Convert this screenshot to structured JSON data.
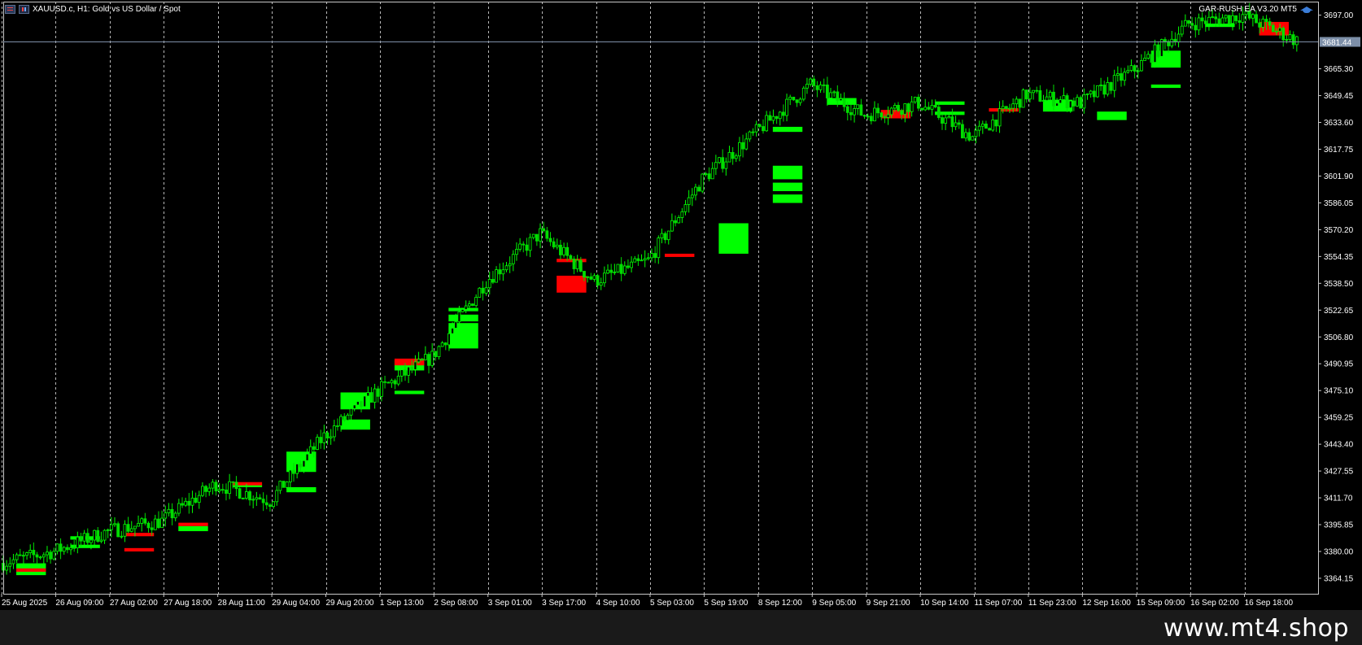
{
  "header": {
    "symbol_title": "XAUUSD.c, H1:  Gold vs US Dollar / Spot",
    "ea_label": "GAR-RUSH  EA V3.20 MT5",
    "icons": [
      "chart-menu-icon",
      "chart-type-icon",
      "expert-hat-icon"
    ]
  },
  "price_axis": {
    "labels": [
      "3697.00",
      "3665.30",
      "3649.45",
      "3633.60",
      "3617.75",
      "3601.90",
      "3586.05",
      "3570.20",
      "3554.35",
      "3538.50",
      "3522.65",
      "3506.80",
      "3490.95",
      "3475.10",
      "3459.25",
      "3443.40",
      "3427.55",
      "3411.70",
      "3395.85",
      "3380.00",
      "3364.15"
    ],
    "current_price": "3681.44"
  },
  "time_axis": {
    "labels": [
      "25 Aug 2025",
      "26 Aug 09:00",
      "27 Aug 02:00",
      "27 Aug 18:00",
      "28 Aug 11:00",
      "29 Aug 04:00",
      "29 Aug 20:00",
      "1 Sep 13:00",
      "2 Sep 08:00",
      "3 Sep 01:00",
      "3 Sep 17:00",
      "4 Sep 10:00",
      "5 Sep 03:00",
      "5 Sep 19:00",
      "8 Sep 12:00",
      "9 Sep 05:00",
      "9 Sep 21:00",
      "10 Sep 14:00",
      "11 Sep 07:00",
      "11 Sep 23:00",
      "12 Sep 16:00",
      "15 Sep 09:00",
      "16 Sep 02:00",
      "16 Sep 18:00"
    ]
  },
  "chart_data": {
    "type": "line",
    "title": "XAUUSD.c, H1:  Gold vs US Dollar / Spot",
    "xlabel": "",
    "ylabel": "",
    "ylim": [
      3355,
      3705
    ],
    "grid": "vertical-dashed",
    "x": [
      "25 Aug 2025",
      "26 Aug 09:00",
      "27 Aug 02:00",
      "27 Aug 18:00",
      "28 Aug 11:00",
      "29 Aug 04:00",
      "29 Aug 20:00",
      "1 Sep 13:00",
      "2 Sep 08:00",
      "3 Sep 01:00",
      "3 Sep 17:00",
      "4 Sep 10:00",
      "5 Sep 03:00",
      "5 Sep 19:00",
      "8 Sep 12:00",
      "9 Sep 05:00",
      "9 Sep 21:00",
      "10 Sep 14:00",
      "11 Sep 07:00",
      "11 Sep 23:00",
      "12 Sep 16:00",
      "15 Sep 09:00",
      "16 Sep 02:00",
      "16 Sep 18:00",
      "16 Sep 23:00"
    ],
    "series": [
      {
        "values": [
          3373,
          3380,
          3392,
          3398,
          3420,
          3410,
          3448,
          3475,
          3495,
          3540,
          3568,
          3540,
          3552,
          3600,
          3628,
          3656,
          3638,
          3645,
          3625,
          3650,
          3645,
          3665,
          3692,
          3697,
          3682
        ]
      }
    ],
    "bull_color": "#00ff00",
    "bear_color": "#ff0000",
    "zones": [
      {
        "kind": "bull",
        "from": "25 Aug 2025",
        "to": "26 Aug 09:00",
        "low": 3366,
        "high": 3373
      },
      {
        "kind": "bear",
        "from": "25 Aug 2025",
        "to": "26 Aug 09:00",
        "low": 3368,
        "high": 3370
      },
      {
        "kind": "bull",
        "from": "26 Aug 09:00",
        "to": "27 Aug 02:00",
        "low": 3382,
        "high": 3384
      },
      {
        "kind": "bull",
        "from": "26 Aug 09:00",
        "to": "27 Aug 02:00",
        "low": 3387,
        "high": 3389
      },
      {
        "kind": "bear",
        "from": "27 Aug 02:00",
        "to": "27 Aug 18:00",
        "low": 3389,
        "high": 3391
      },
      {
        "kind": "bear",
        "from": "27 Aug 02:00",
        "to": "27 Aug 18:00",
        "low": 3380,
        "high": 3382
      },
      {
        "kind": "bull",
        "from": "27 Aug 18:00",
        "to": "28 Aug 11:00",
        "low": 3392,
        "high": 3395
      },
      {
        "kind": "bear",
        "from": "27 Aug 18:00",
        "to": "28 Aug 11:00",
        "low": 3395,
        "high": 3397
      },
      {
        "kind": "bull",
        "from": "28 Aug 11:00",
        "to": "29 Aug 04:00",
        "low": 3418,
        "high": 3420
      },
      {
        "kind": "bear",
        "from": "28 Aug 11:00",
        "to": "29 Aug 04:00",
        "low": 3420,
        "high": 3421
      },
      {
        "kind": "bull",
        "from": "29 Aug 04:00",
        "to": "29 Aug 20:00",
        "low": 3427,
        "high": 3439
      },
      {
        "kind": "bull",
        "from": "29 Aug 04:00",
        "to": "29 Aug 20:00",
        "low": 3415,
        "high": 3418
      },
      {
        "kind": "bull",
        "from": "29 Aug 20:00",
        "to": "1 Sep 13:00",
        "low": 3452,
        "high": 3458
      },
      {
        "kind": "bull",
        "from": "29 Aug 20:00",
        "to": "1 Sep 13:00",
        "low": 3464,
        "high": 3474
      },
      {
        "kind": "bull",
        "from": "1 Sep 13:00",
        "to": "2 Sep 08:00",
        "low": 3473,
        "high": 3475
      },
      {
        "kind": "bull",
        "from": "1 Sep 13:00",
        "to": "2 Sep 08:00",
        "low": 3487,
        "high": 3493
      },
      {
        "kind": "bear",
        "from": "1 Sep 13:00",
        "to": "2 Sep 08:00",
        "low": 3490,
        "high": 3494
      },
      {
        "kind": "bull",
        "from": "2 Sep 08:00",
        "to": "3 Sep 01:00",
        "low": 3500,
        "high": 3515
      },
      {
        "kind": "bull",
        "from": "2 Sep 08:00",
        "to": "3 Sep 01:00",
        "low": 3516,
        "high": 3520
      },
      {
        "kind": "bull",
        "from": "2 Sep 08:00",
        "to": "3 Sep 01:00",
        "low": 3522,
        "high": 3524
      },
      {
        "kind": "bear",
        "from": "3 Sep 17:00",
        "to": "4 Sep 10:00",
        "low": 3533,
        "high": 3543
      },
      {
        "kind": "bear",
        "from": "3 Sep 17:00",
        "to": "4 Sep 10:00",
        "low": 3551,
        "high": 3553
      },
      {
        "kind": "bull",
        "from": "5 Sep 19:00",
        "to": "8 Sep 12:00",
        "low": 3556,
        "high": 3574
      },
      {
        "kind": "bear",
        "from": "5 Sep 03:00",
        "to": "5 Sep 19:00",
        "low": 3555,
        "high": 3556
      },
      {
        "kind": "bull",
        "from": "8 Sep 12:00",
        "to": "9 Sep 05:00",
        "low": 3586,
        "high": 3591
      },
      {
        "kind": "bull",
        "from": "8 Sep 12:00",
        "to": "9 Sep 05:00",
        "low": 3593,
        "high": 3598
      },
      {
        "kind": "bull",
        "from": "8 Sep 12:00",
        "to": "9 Sep 05:00",
        "low": 3600,
        "high": 3608
      },
      {
        "kind": "bull",
        "from": "8 Sep 12:00",
        "to": "9 Sep 05:00",
        "low": 3628,
        "high": 3631
      },
      {
        "kind": "bull",
        "from": "9 Sep 05:00",
        "to": "9 Sep 21:00",
        "low": 3644,
        "high": 3648
      },
      {
        "kind": "bear",
        "from": "9 Sep 21:00",
        "to": "10 Sep 14:00",
        "low": 3636,
        "high": 3641
      },
      {
        "kind": "bull",
        "from": "10 Sep 14:00",
        "to": "11 Sep 07:00",
        "low": 3638,
        "high": 3640
      },
      {
        "kind": "bull",
        "from": "10 Sep 14:00",
        "to": "11 Sep 07:00",
        "low": 3644,
        "high": 3646
      },
      {
        "kind": "bear",
        "from": "11 Sep 07:00",
        "to": "11 Sep 23:00",
        "low": 3640,
        "high": 3642
      },
      {
        "kind": "bull",
        "from": "11 Sep 23:00",
        "to": "12 Sep 16:00",
        "low": 3640,
        "high": 3647
      },
      {
        "kind": "bull",
        "from": "12 Sep 16:00",
        "to": "15 Sep 09:00",
        "low": 3635,
        "high": 3640
      },
      {
        "kind": "bull",
        "from": "15 Sep 09:00",
        "to": "16 Sep 02:00",
        "low": 3654,
        "high": 3656
      },
      {
        "kind": "bull",
        "from": "15 Sep 09:00",
        "to": "16 Sep 02:00",
        "low": 3666,
        "high": 3676
      },
      {
        "kind": "bull",
        "from": "16 Sep 02:00",
        "to": "16 Sep 18:00",
        "low": 3690,
        "high": 3692
      },
      {
        "kind": "bear",
        "from": "16 Sep 18:00",
        "to": "16 Sep 23:00",
        "low": 3685,
        "high": 3693
      }
    ]
  },
  "footer": {
    "watermark": "www.mt4.shop"
  }
}
